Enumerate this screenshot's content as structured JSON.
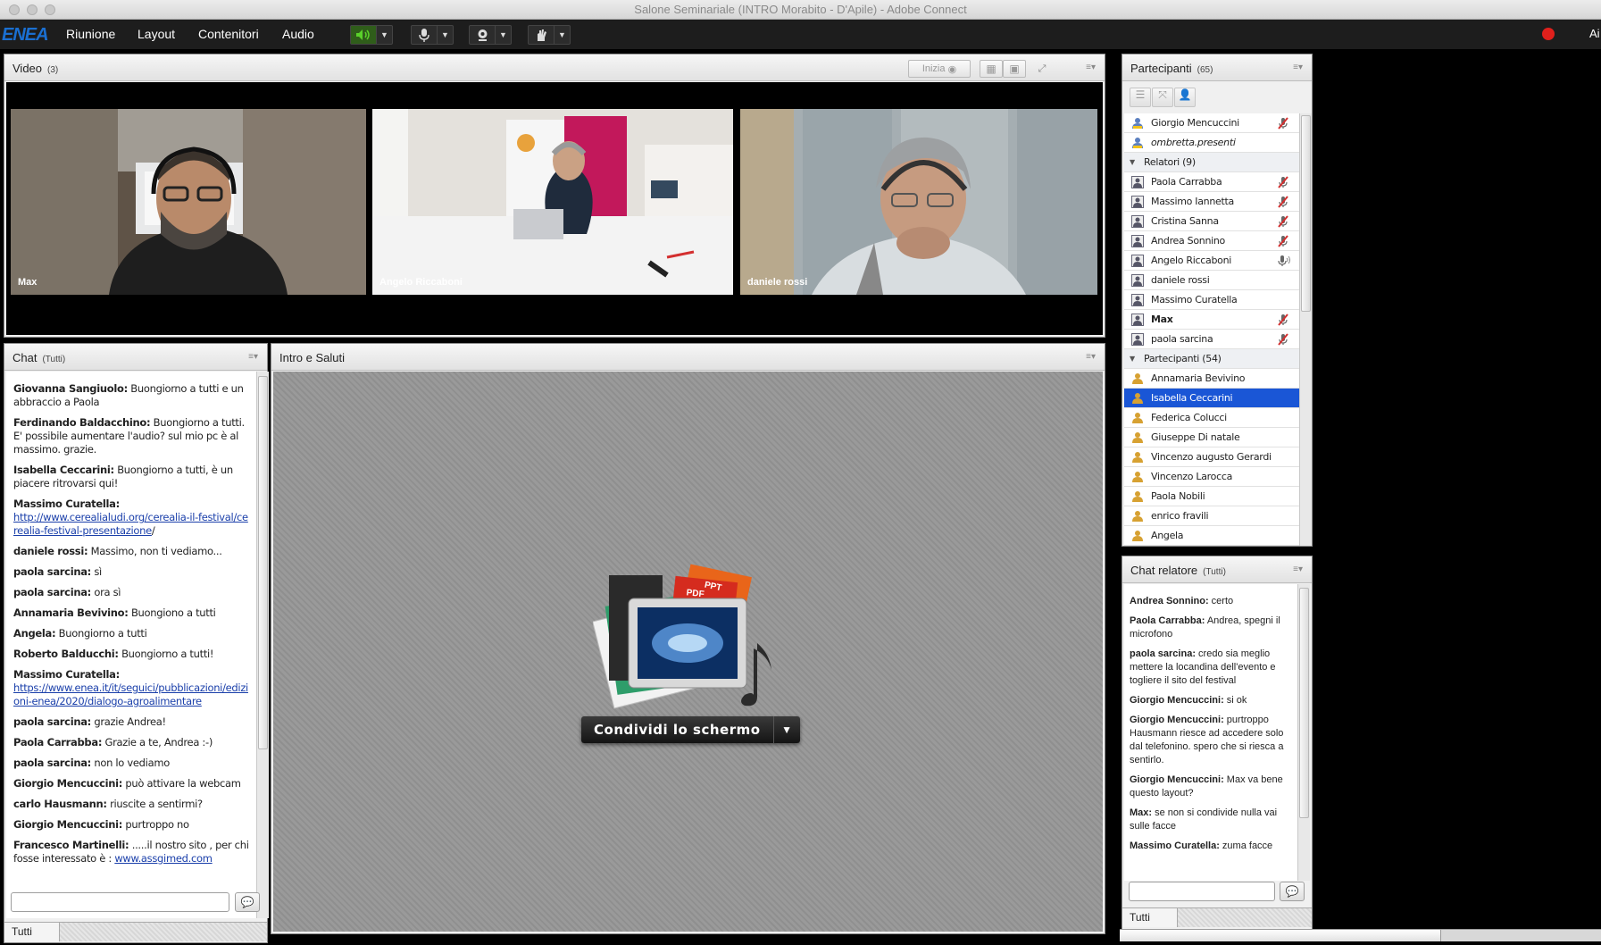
{
  "window": {
    "title": "Salone Seminariale (INTRO Morabito - D'Apile) - Adobe Connect"
  },
  "menubar": {
    "logo": "ENEA",
    "items": [
      "Riunione",
      "Layout",
      "Contenitori",
      "Audio"
    ],
    "right_edge_text": "Ai"
  },
  "video_pod": {
    "title": "Video",
    "count": "(3)",
    "start_button": "Inizia",
    "tiles": [
      {
        "name": "Max"
      },
      {
        "name": "Angelo Riccaboni"
      },
      {
        "name": "daniele rossi"
      }
    ]
  },
  "chat_pod": {
    "title": "Chat",
    "scope": "(Tutti)",
    "tab_label": "Tutti",
    "messages": [
      {
        "author": "Giovanna Sangiuolo:",
        "text": " Buongiorno a tutti e un abbraccio a Paola"
      },
      {
        "author": "Ferdinando Baldacchino:",
        "text": " Buongiorno a tutti.  E' possibile aumentare l'audio? sul mio pc è al massimo. grazie."
      },
      {
        "author": "Isabella Ceccarini:",
        "text": " Buongiorno a tutti, è un piacere ritrovarsi qui!"
      },
      {
        "author": "Massimo Curatella:",
        "text": "",
        "link": "http://www.cerealialudi.org/cerealia-il-festival/cerealia-festival-presentazione",
        "after": "/"
      },
      {
        "author": "daniele rossi:",
        "text": " Massimo, non ti vediamo..."
      },
      {
        "author": "paola sarcina:",
        "text": " sì"
      },
      {
        "author": "paola sarcina:",
        "text": " ora sì"
      },
      {
        "author": "Annamaria Bevivino:",
        "text": " Buongiono a tutti"
      },
      {
        "author": "Angela:",
        "text": " Buongiorno a tutti"
      },
      {
        "author": "Roberto Balducchi:",
        "text": " Buongiorno a tutti!"
      },
      {
        "author": "Massimo Curatella:",
        "text": "",
        "link": "https://www.enea.it/it/seguici/pubblicazioni/edizioni-enea/2020/dialogo-agroalimentare",
        "after": ""
      },
      {
        "author": "paola sarcina:",
        "text": " grazie Andrea!"
      },
      {
        "author": "Paola Carrabba:",
        "text": " Grazie a te, Andrea :-)"
      },
      {
        "author": "paola sarcina:",
        "text": " non lo vediamo"
      },
      {
        "author": "Giorgio Mencuccini:",
        "text": " può attivare la webcam"
      },
      {
        "author": "carlo Hausmann:",
        "text": " riuscite a sentirmi?"
      },
      {
        "author": "Giorgio Mencuccini:",
        "text": " purtroppo no"
      },
      {
        "author": "Francesco Martinelli:",
        "text": " .....il nostro sito , per chi fosse interessato è : ",
        "link": "www.assgimed.com",
        "after": ""
      }
    ]
  },
  "share_pod": {
    "title": "Intro e Saluti",
    "share_button": "Condividi lo schermo",
    "graphic_labels": [
      "PPT",
      "PDF"
    ]
  },
  "participants_pod": {
    "title": "Partecipanti",
    "count": "(65)",
    "rows": [
      {
        "kind": "host",
        "name": "Giorgio Mencuccini",
        "mic": true
      },
      {
        "kind": "host",
        "name": "ombretta.presenti",
        "italic": true
      },
      {
        "kind": "group",
        "name": "Relatori (9)"
      },
      {
        "kind": "presenter",
        "name": "Paola Carrabba",
        "mic": true
      },
      {
        "kind": "presenter",
        "name": "Massimo Iannetta",
        "mic": true
      },
      {
        "kind": "presenter",
        "name": "Cristina Sanna",
        "mic": true
      },
      {
        "kind": "presenter",
        "name": "Andrea Sonnino",
        "mic": true
      },
      {
        "kind": "presenter",
        "name": "Angelo Riccaboni",
        "speaking": true
      },
      {
        "kind": "presenter",
        "name": "daniele rossi"
      },
      {
        "kind": "presenter",
        "name": "Massimo Curatella"
      },
      {
        "kind": "presenter",
        "name": "Max",
        "mic": true,
        "bold": true
      },
      {
        "kind": "presenter",
        "name": "paola sarcina",
        "mic": true
      },
      {
        "kind": "group",
        "name": "Partecipanti (54)"
      },
      {
        "kind": "participant",
        "name": "Annamaria Bevivino"
      },
      {
        "kind": "participant",
        "name": "Isabella Ceccarini",
        "selected": true
      },
      {
        "kind": "participant",
        "name": "Federica Colucci"
      },
      {
        "kind": "participant",
        "name": "Giuseppe Di natale"
      },
      {
        "kind": "participant",
        "name": "Vincenzo augusto Gerardi"
      },
      {
        "kind": "participant",
        "name": "Vincenzo Larocca"
      },
      {
        "kind": "participant",
        "name": "Paola Nobili"
      },
      {
        "kind": "participant",
        "name": "enrico fravili"
      },
      {
        "kind": "participant",
        "name": "Angela"
      }
    ]
  },
  "host_chat_pod": {
    "title": "Chat relatore",
    "scope": "(Tutti)",
    "tab_label": "Tutti",
    "messages": [
      {
        "author": "Andrea Sonnino:",
        "text": " certo"
      },
      {
        "author": "Paola Carrabba:",
        "text": " Andrea, spegni il microfono"
      },
      {
        "author": "paola sarcina:",
        "text": " credo sia meglio mettere la locandina dell'evento e togliere il sito del festival"
      },
      {
        "author": "Giorgio Mencuccini:",
        "text": " si ok"
      },
      {
        "author": "Giorgio Mencuccini:",
        "text": " purtroppo Hausmann riesce ad accedere solo dal telefonino. spero che si riesca a sentirlo."
      },
      {
        "author": "Giorgio Mencuccini:",
        "text": " Max va bene questo layout?"
      },
      {
        "author": "Max:",
        "text": " se non si condivide nulla vai sulle facce"
      },
      {
        "author": "Massimo Curatella:",
        "text": " zuma facce"
      }
    ]
  },
  "colors": {
    "accent_selection": "#1a56d6",
    "speaker_active": "#5ad12a",
    "record": "#e0201c",
    "logo": "#1a6fd1"
  }
}
